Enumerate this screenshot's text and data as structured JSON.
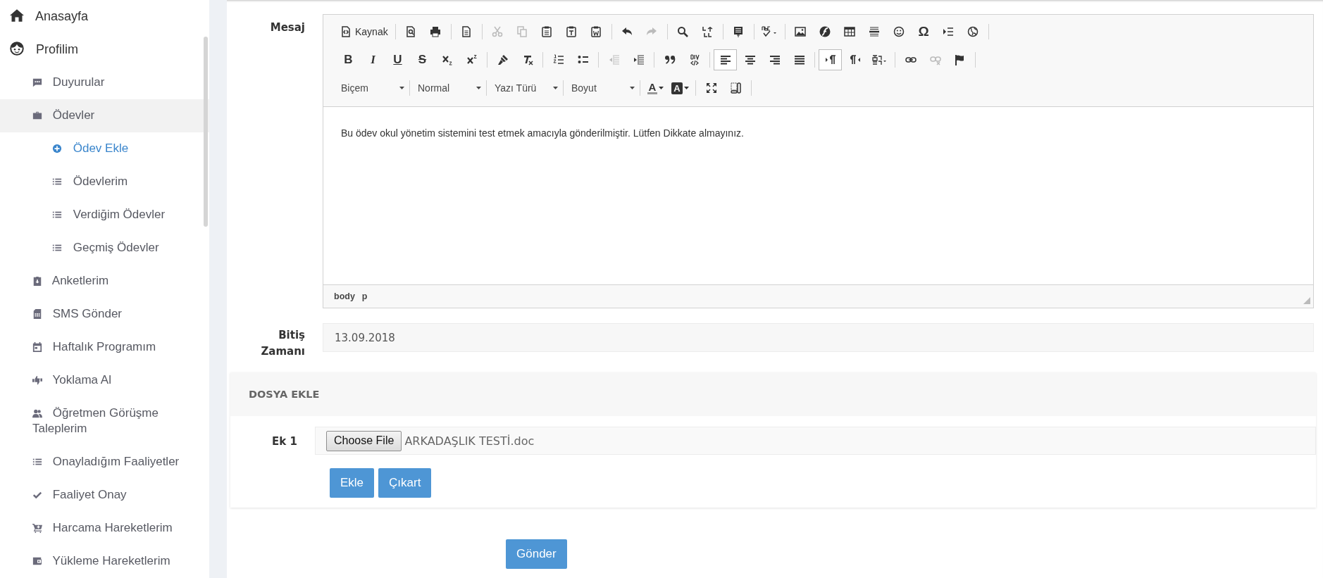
{
  "sidebar": {
    "items": [
      {
        "label": "Anasayfa",
        "selected": false
      },
      {
        "label": "Profilim",
        "selected": false,
        "children": [
          {
            "label": "Duyurular",
            "selected": false
          },
          {
            "label": "Ödevler",
            "selected": false,
            "expanded": true,
            "children": [
              {
                "label": "Ödev Ekle",
                "selected": true
              },
              {
                "label": "Ödevlerim",
                "selected": false
              },
              {
                "label": "Verdiğim Ödevler",
                "selected": false
              },
              {
                "label": "Geçmiş Ödevler",
                "selected": false
              }
            ]
          },
          {
            "label": "Anketlerim",
            "selected": false
          },
          {
            "label": "SMS Gönder",
            "selected": false
          },
          {
            "label": "Haftalık Programım",
            "selected": false
          },
          {
            "label": "Yoklama Al",
            "selected": false
          },
          {
            "label": "Öğretmen Görüşme Taleplerim",
            "selected": false
          },
          {
            "label": "Onayladığım Faaliyetler",
            "selected": false
          },
          {
            "label": "Faaliyet Onay",
            "selected": false
          },
          {
            "label": "Harcama Hareketlerim",
            "selected": false
          },
          {
            "label": "Yükleme Hareketlerim",
            "selected": false
          }
        ]
      }
    ]
  },
  "form": {
    "message": {
      "label": "Mesaj",
      "toolbar_rows": [
        [
          [
            {
              "kind": "source",
              "label": "Kaynak",
              "disabled": false,
              "selected": false
            }
          ],
          [
            {
              "kind": "preview",
              "disabled": false,
              "selected": false
            },
            {
              "kind": "print",
              "disabled": false,
              "selected": false
            }
          ],
          [
            {
              "kind": "templates",
              "disabled": false,
              "selected": false
            }
          ],
          [
            {
              "kind": "cut",
              "disabled": true,
              "selected": false
            },
            {
              "kind": "copy",
              "disabled": true,
              "selected": false
            },
            {
              "kind": "paste",
              "disabled": false,
              "selected": false
            },
            {
              "kind": "pastetext",
              "disabled": false,
              "selected": false
            },
            {
              "kind": "pasteword",
              "disabled": false,
              "selected": false
            }
          ],
          [
            {
              "kind": "undo",
              "disabled": false,
              "selected": false
            },
            {
              "kind": "redo",
              "disabled": true,
              "selected": false
            }
          ],
          [
            {
              "kind": "find",
              "disabled": false,
              "selected": false
            },
            {
              "kind": "replace",
              "disabled": false,
              "selected": false
            }
          ],
          [
            {
              "kind": "selectall",
              "disabled": false,
              "selected": false
            }
          ],
          [
            {
              "kind": "spellcheck",
              "disabled": false,
              "selected": false
            }
          ],
          [
            {
              "kind": "image",
              "disabled": false,
              "selected": false
            },
            {
              "kind": "flash",
              "disabled": false,
              "selected": false
            },
            {
              "kind": "table",
              "disabled": false,
              "selected": false
            },
            {
              "kind": "hr",
              "disabled": false,
              "selected": false
            },
            {
              "kind": "smiley",
              "disabled": false,
              "selected": false
            },
            {
              "kind": "specialchar",
              "label": "Ω",
              "disabled": false,
              "selected": false
            },
            {
              "kind": "pagebreak",
              "disabled": false,
              "selected": false
            },
            {
              "kind": "iframe",
              "disabled": false,
              "selected": false
            }
          ]
        ],
        [
          [
            {
              "kind": "bold",
              "label": "B",
              "disabled": false,
              "selected": false
            },
            {
              "kind": "italic",
              "label": "I",
              "disabled": false,
              "selected": false
            },
            {
              "kind": "underline",
              "label": "U",
              "disabled": false,
              "selected": false
            },
            {
              "kind": "strike",
              "label": "S",
              "disabled": false,
              "selected": false
            },
            {
              "kind": "subscript",
              "disabled": false,
              "selected": false
            },
            {
              "kind": "superscript",
              "disabled": false,
              "selected": false
            }
          ],
          [
            {
              "kind": "copyformat",
              "disabled": false,
              "selected": false
            },
            {
              "kind": "removeformat",
              "disabled": false,
              "selected": false
            }
          ],
          [
            {
              "kind": "numbered",
              "disabled": false,
              "selected": false
            },
            {
              "kind": "bulleted",
              "disabled": false,
              "selected": false
            }
          ],
          [
            {
              "kind": "outdent",
              "disabled": true,
              "selected": false
            },
            {
              "kind": "indent",
              "disabled": false,
              "selected": false
            }
          ],
          [
            {
              "kind": "blockquote",
              "disabled": false,
              "selected": false
            },
            {
              "kind": "creatediv",
              "disabled": false,
              "selected": false
            }
          ],
          [
            {
              "kind": "alignleft",
              "disabled": false,
              "selected": true
            },
            {
              "kind": "aligncenter",
              "disabled": false,
              "selected": false
            },
            {
              "kind": "alignright",
              "disabled": false,
              "selected": false
            },
            {
              "kind": "justify",
              "disabled": false,
              "selected": false
            }
          ],
          [
            {
              "kind": "ltr",
              "disabled": false,
              "selected": true
            },
            {
              "kind": "rtl",
              "disabled": false,
              "selected": false
            },
            {
              "kind": "language",
              "disabled": false,
              "selected": false
            }
          ],
          [
            {
              "kind": "link",
              "disabled": false,
              "selected": false
            },
            {
              "kind": "unlink",
              "disabled": true,
              "selected": false
            },
            {
              "kind": "anchor",
              "disabled": false,
              "selected": false
            }
          ]
        ],
        [
          [
            {
              "kind": "combo",
              "label": "Biçem",
              "disabled": false,
              "selected": false
            }
          ],
          [
            {
              "kind": "combo",
              "label": "Normal",
              "disabled": false,
              "selected": false
            }
          ],
          [
            {
              "kind": "combo",
              "label": "Yazı Türü",
              "disabled": false,
              "selected": false
            }
          ],
          [
            {
              "kind": "combo",
              "label": "Boyut",
              "disabled": false,
              "selected": false
            }
          ],
          [
            {
              "kind": "textcolor",
              "label": "A",
              "disabled": false,
              "selected": false
            },
            {
              "kind": "bgcolor",
              "label": "A",
              "disabled": false,
              "selected": false
            }
          ],
          [
            {
              "kind": "maximize",
              "disabled": false,
              "selected": false
            },
            {
              "kind": "showblocks",
              "disabled": false,
              "selected": false
            }
          ]
        ]
      ],
      "content": "Bu ödev okul yönetim sistemini test etmek amacıyla gönderilmiştir. Lütfen Dikkate almayınız.",
      "path": [
        "body",
        "p"
      ]
    },
    "due": {
      "label": "Bitiş Zamanı",
      "value": "13.09.2018"
    },
    "attachments": {
      "title": "DOSYA EKLE",
      "label": "Ek 1",
      "choose_button": "Choose File",
      "file_name": "ARKADAŞLIK TESTİ.doc",
      "buttons": [
        "Ekle",
        "Çıkart"
      ]
    },
    "submit": "Gönder"
  }
}
